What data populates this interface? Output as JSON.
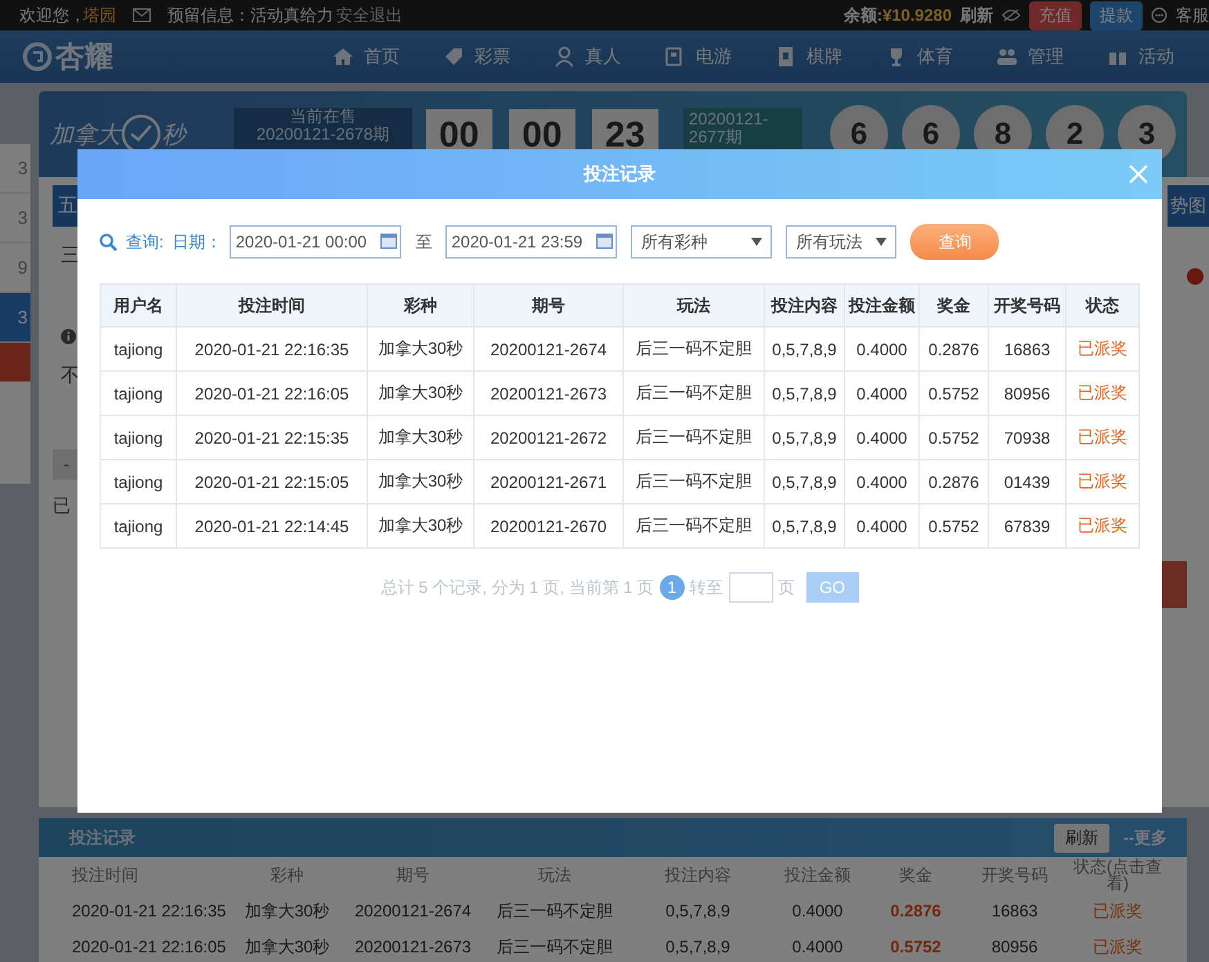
{
  "top_bar": {
    "welcome": "欢迎您，",
    "username": "塔园",
    "notice": "预留信息：活动真给力",
    "logout": "安全退出",
    "balance_label": "余额:",
    "balance": "¥10.9280",
    "refresh": "刷新",
    "deposit": "充值",
    "withdraw": "提款",
    "service": "客服"
  },
  "nav": {
    "logo": "杏耀",
    "items": [
      "首页",
      "彩票",
      "真人",
      "电游",
      "棋牌",
      "体育",
      "管理",
      "活动"
    ]
  },
  "lottery_header": {
    "name_left": "加拿大",
    "name_right": "秒",
    "on_sale_label": "当前在售",
    "on_sale_issue": "20200121-2678期",
    "countdown": [
      "00",
      "00",
      "23"
    ],
    "last_issue": "20200121-2677期",
    "balls": [
      "6",
      "6",
      "8",
      "2",
      "3"
    ]
  },
  "side_list": [
    {
      "label": "3",
      "selected": false
    },
    {
      "label": "3",
      "selected": false
    },
    {
      "label": "9",
      "selected": false
    },
    {
      "label": "3",
      "selected": true
    }
  ],
  "fragments": {
    "tab": "五",
    "row_1": "三",
    "row_2": "不",
    "minus": "-",
    "selected_text": "已",
    "trend": "势图"
  },
  "modal": {
    "title": "投注记录",
    "filter": {
      "query_label": "查询:",
      "date_label": "日期：",
      "date_from": "2020-01-21 00:00",
      "to_label": "至",
      "date_to": "2020-01-21 23:59",
      "lottery_select": "所有彩种",
      "method_select": "所有玩法",
      "search_button": "查询"
    },
    "columns": [
      "用户名",
      "投注时间",
      "彩种",
      "期号",
      "玩法",
      "投注内容",
      "投注金额",
      "奖金",
      "开奖号码",
      "状态"
    ],
    "rows": [
      [
        "tajiong",
        "2020-01-21 22:16:35",
        "加拿大30秒",
        "20200121-2674",
        "后三一码不定胆",
        "0,5,7,8,9",
        "0.4000",
        "0.2876",
        "16863",
        "已派奖"
      ],
      [
        "tajiong",
        "2020-01-21 22:16:05",
        "加拿大30秒",
        "20200121-2673",
        "后三一码不定胆",
        "0,5,7,8,9",
        "0.4000",
        "0.5752",
        "80956",
        "已派奖"
      ],
      [
        "tajiong",
        "2020-01-21 22:15:35",
        "加拿大30秒",
        "20200121-2672",
        "后三一码不定胆",
        "0,5,7,8,9",
        "0.4000",
        "0.5752",
        "70938",
        "已派奖"
      ],
      [
        "tajiong",
        "2020-01-21 22:15:05",
        "加拿大30秒",
        "20200121-2671",
        "后三一码不定胆",
        "0,5,7,8,9",
        "0.4000",
        "0.2876",
        "01439",
        "已派奖"
      ],
      [
        "tajiong",
        "2020-01-21 22:14:45",
        "加拿大30秒",
        "20200121-2670",
        "后三一码不定胆",
        "0,5,7,8,9",
        "0.4000",
        "0.5752",
        "67839",
        "已派奖"
      ]
    ],
    "pagination": {
      "summary": "总计 5 个记录, 分为 1 页, 当前第 1 页",
      "current_page": "1",
      "goto_label": "转至",
      "page_label": "页",
      "go_button": "GO"
    }
  },
  "bottom_panel": {
    "title": "投注记录",
    "refresh": "刷新",
    "more": "--更多",
    "columns": [
      "投注时间",
      "彩种",
      "期号",
      "玩法",
      "投注内容",
      "投注金额",
      "奖金",
      "开奖号码",
      "状态(点击查看)"
    ],
    "rows": [
      [
        "2020-01-21 22:16:35",
        "加拿大30秒",
        "20200121-2674",
        "后三一码不定胆",
        "0,5,7,8,9",
        "0.4000",
        "0.2876",
        "16863",
        "已派奖"
      ],
      [
        "2020-01-21 22:16:05",
        "加拿大30秒",
        "20200121-2673",
        "后三一码不定胆",
        "0,5,7,8,9",
        "0.4000",
        "0.5752",
        "80956",
        "已派奖"
      ]
    ]
  }
}
